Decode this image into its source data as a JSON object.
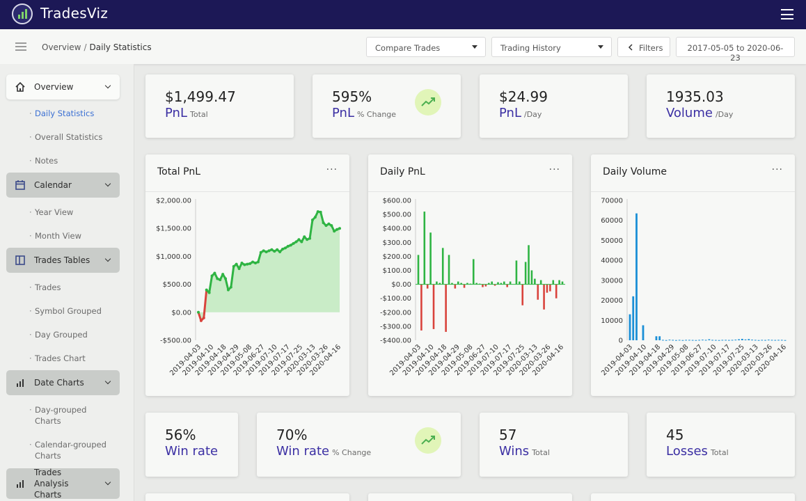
{
  "app": {
    "name": "TradesViz"
  },
  "breadcrumb": {
    "root": "Overview",
    "separator": "/",
    "current": "Daily Statistics"
  },
  "toolbar": {
    "compare": "Compare Trades",
    "history": "Trading History",
    "filters": "Filters",
    "date_range": "2017-05-05 to 2020-06-23"
  },
  "sidebar": {
    "groups": [
      {
        "label": "Overview",
        "subitems": [
          "Daily Statistics",
          "Overall Statistics",
          "Notes"
        ]
      },
      {
        "label": "Calendar",
        "subitems": [
          "Year View",
          "Month View"
        ]
      },
      {
        "label": "Trades Tables",
        "subitems": [
          "Trades",
          "Symbol Grouped",
          "Day Grouped",
          "Trades Chart"
        ]
      },
      {
        "label": "Date Charts",
        "subitems": [
          "Day-grouped Charts",
          "Calendar-grouped Charts"
        ]
      },
      {
        "label": "Trades Analysis Charts",
        "subitems": []
      }
    ],
    "active_item": "Daily Statistics"
  },
  "stats_top": [
    {
      "value": "$1,499.47",
      "label": "PnL",
      "sub": "Total"
    },
    {
      "value": "595%",
      "label": "PnL",
      "sub": "% Change"
    },
    {
      "value": "$24.99",
      "label": "PnL",
      "sub": "/Day"
    },
    {
      "value": "1935.03",
      "label": "Volume",
      "sub": "/Day"
    }
  ],
  "stats_bottom": [
    {
      "value": "56%",
      "label": "Win rate",
      "sub": ""
    },
    {
      "value": "70%",
      "label": "Win rate",
      "sub": "% Change"
    },
    {
      "value": "57",
      "label": "Wins",
      "sub": "Total"
    },
    {
      "value": "45",
      "label": "Losses",
      "sub": "Total"
    }
  ],
  "menu_glyph": "···",
  "colors": {
    "accent": "#3b2fa3",
    "topbar": "#1c1856",
    "positive": "#2fb443",
    "negative": "#d9433c",
    "volume": "#1a8fd6",
    "trend_badge": "#e1f5b8"
  },
  "icons": {
    "trend": "trending-up-icon",
    "overview": "home-icon",
    "calendar": "calendar-icon",
    "tables": "table-icon",
    "charts": "bar-chart-icon"
  },
  "chart_data": [
    {
      "type": "area",
      "title": "Total PnL",
      "ylim": [
        -500,
        2000
      ],
      "yticks": [
        "$2,000.00",
        "$1,500.00",
        "$1,000.00",
        "$500.00",
        "$0.00",
        "-$500.00"
      ],
      "xticks": [
        "2019-04-03",
        "2019-04-10",
        "2019-04-18",
        "2019-04-29",
        "2019-05-08",
        "2019-06-27",
        "2019-07-10",
        "2019-07-17",
        "2019-07-25",
        "2020-03-13",
        "2020-03-26",
        "2020-04-16"
      ],
      "values": [
        0,
        -150,
        -100,
        400,
        350,
        650,
        700,
        600,
        580,
        680,
        600,
        400,
        450,
        820,
        860,
        780,
        880,
        850,
        860,
        870,
        900,
        880,
        900,
        1070,
        1100,
        1080,
        1100,
        1120,
        1090,
        1120,
        1080,
        1130,
        1150,
        1180,
        1200,
        1230,
        1260,
        1300,
        1260,
        1350,
        1300,
        1320,
        1650,
        1700,
        1800,
        1790,
        1600,
        1550,
        1580,
        1550,
        1450,
        1480,
        1500
      ],
      "grid": true
    },
    {
      "type": "bar",
      "title": "Daily PnL",
      "ylim": [
        -400,
        600
      ],
      "yticks": [
        "$600.00",
        "$500.00",
        "$400.00",
        "$300.00",
        "$200.00",
        "$100.00",
        "$0.00",
        "-$100.00",
        "-$200.00",
        "-$300.00",
        "-$400.00"
      ],
      "xticks": [
        "2019-04-03",
        "2019-04-10",
        "2019-04-18",
        "2019-04-29",
        "2019-05-08",
        "2019-06-27",
        "2019-07-10",
        "2019-07-17",
        "2019-07-25",
        "2020-03-13",
        "2020-03-26",
        "2020-04-16"
      ],
      "values": [
        210,
        -330,
        520,
        -30,
        370,
        -320,
        20,
        10,
        260,
        -340,
        210,
        10,
        -30,
        20,
        10,
        -25,
        10,
        5,
        180,
        10,
        5,
        -20,
        -15,
        10,
        20,
        -10,
        15,
        10,
        20,
        -20,
        20,
        0,
        170,
        20,
        -150,
        160,
        280,
        100,
        40,
        -110,
        30,
        -180,
        -60,
        -50,
        30,
        -100,
        30,
        20
      ],
      "grid": true
    },
    {
      "type": "bar",
      "title": "Daily Volume",
      "ylim": [
        0,
        70000
      ],
      "yticks": [
        "70000",
        "60000",
        "50000",
        "40000",
        "30000",
        "20000",
        "10000",
        "0"
      ],
      "xticks": [
        "2019-04-03",
        "2019-04-10",
        "2019-04-18",
        "2019-04-29",
        "2019-05-08",
        "2019-06-27",
        "2019-07-10",
        "2019-07-17",
        "2019-07-25",
        "2020-03-13",
        "2020-03-26",
        "2020-04-16"
      ],
      "values": [
        13000,
        22000,
        63500,
        0,
        7500,
        0,
        0,
        0,
        2000,
        2000,
        200,
        100,
        300,
        200,
        100,
        200,
        100,
        200,
        200,
        150,
        100,
        200,
        300,
        200,
        500,
        200,
        150,
        100,
        200,
        200,
        150,
        200,
        300,
        500,
        700,
        400,
        600,
        300,
        200,
        100,
        200,
        150,
        300,
        200,
        150,
        200,
        200,
        100
      ],
      "grid": true
    }
  ]
}
